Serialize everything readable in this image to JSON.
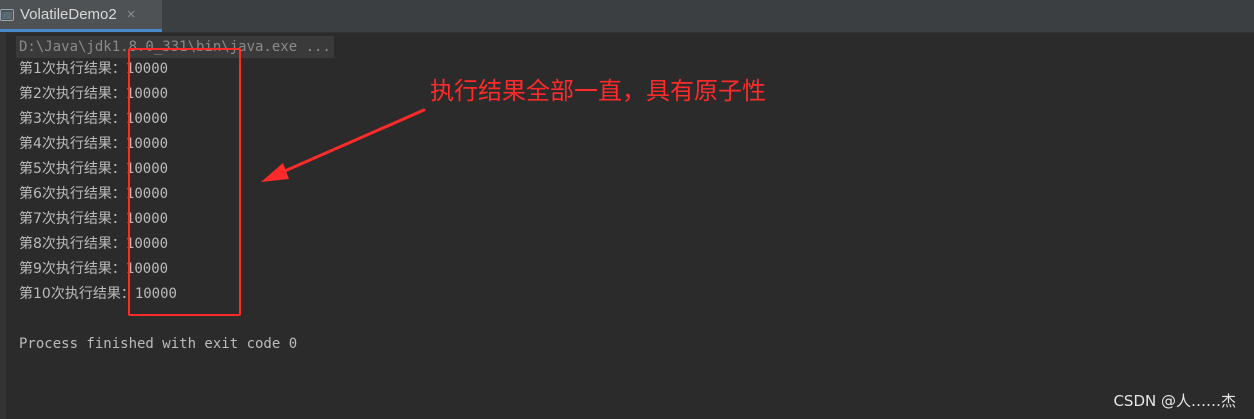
{
  "tab": {
    "title": "VolatileDemo2",
    "close_glyph": "×",
    "icon": "console-window-icon"
  },
  "console": {
    "command": "D:\\Java\\jdk1.8.0_331\\bin\\java.exe ...",
    "lines": [
      {
        "label": "第1次执行结果：",
        "value": "10000"
      },
      {
        "label": "第2次执行结果：",
        "value": "10000"
      },
      {
        "label": "第3次执行结果：",
        "value": "10000"
      },
      {
        "label": "第4次执行结果：",
        "value": "10000"
      },
      {
        "label": "第5次执行结果：",
        "value": "10000"
      },
      {
        "label": "第6次执行结果：",
        "value": "10000"
      },
      {
        "label": "第7次执行结果：",
        "value": "10000"
      },
      {
        "label": "第8次执行结果：",
        "value": "10000"
      },
      {
        "label": "第9次执行结果：",
        "value": "10000"
      },
      {
        "label": "第10次执行结果：",
        "value": "10000"
      }
    ],
    "finish": "Process finished with exit code 0"
  },
  "annotation": {
    "text": "执行结果全部一直，具有原子性",
    "color": "#ff2a2a"
  },
  "watermark": "CSDN @人……杰",
  "colors": {
    "background": "#2b2b2b",
    "text": "#bbbbbb",
    "tab_active_underline": "#4a88c7"
  }
}
